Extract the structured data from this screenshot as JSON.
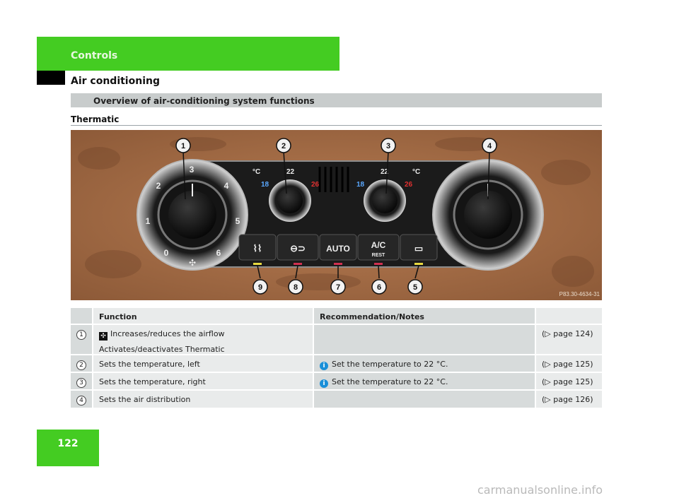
{
  "header": {
    "section": "Controls",
    "subsection": "Air conditioning"
  },
  "overview_title": "Overview of air-conditioning system functions",
  "system_name": "Thermatic",
  "photo": {
    "reference_code": "P83.30-4634-31",
    "callouts": [
      "1",
      "2",
      "3",
      "4",
      "5",
      "6",
      "7",
      "8",
      "9"
    ],
    "left_dial_numbers": [
      "0",
      "1",
      "2",
      "3",
      "4",
      "5",
      "6"
    ],
    "temp_labels": {
      "unit": "°C",
      "mid": "22",
      "low": "18",
      "high": "26"
    },
    "buttons": {
      "auto": "AUTO",
      "ac": "A/C",
      "rest": "REST"
    }
  },
  "table": {
    "headers": {
      "function": "Function",
      "notes": "Recommendation/Notes"
    },
    "rows": [
      {
        "num": "1",
        "function_line1": "Increases/reduces the airflow",
        "function_line2": "Activates/deactivates Thermatic",
        "note": "",
        "page": "(▷ page 124)"
      },
      {
        "num": "2",
        "function_line1": "Sets the temperature, left",
        "note": "Set the temperature to 22 °C.",
        "page": "(▷ page 125)"
      },
      {
        "num": "3",
        "function_line1": "Sets the temperature, right",
        "note": "Set the temperature to 22 °C.",
        "page": "(▷ page 125)"
      },
      {
        "num": "4",
        "function_line1": "Sets the air distribution",
        "note": "",
        "page": "(▷ page 126)"
      }
    ]
  },
  "page_number": "122",
  "watermark": "carmanualsonline.info",
  "colors": {
    "accent_green": "#44cc22",
    "info_blue": "#1a8fd8"
  }
}
